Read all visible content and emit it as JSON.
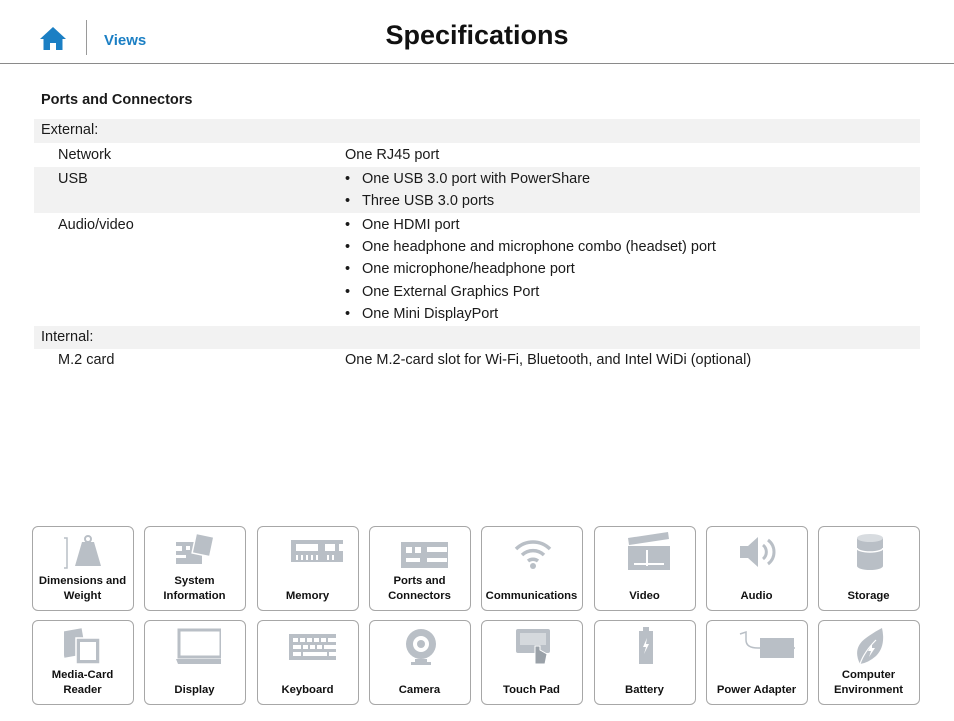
{
  "header": {
    "home_icon": "home-icon",
    "views_label": "Views",
    "title": "Specifications"
  },
  "section_title": "Ports and Connectors",
  "table": {
    "external_label": "External:",
    "network_label": "Network",
    "network_value": "One RJ45 port",
    "usb_label": "USB",
    "usb_items": [
      "One USB 3.0 port with PowerShare",
      "Three USB 3.0 ports"
    ],
    "av_label": "Audio/video",
    "av_items": [
      "One HDMI port",
      "One headphone and microphone combo (headset) port",
      "One microphone/headphone port",
      "One External Graphics Port",
      "One Mini DisplayPort"
    ],
    "internal_label": "Internal:",
    "m2_label": "M.2 card",
    "m2_value": "One M.2-card slot for Wi-Fi, Bluetooth, and Intel WiDi (optional)"
  },
  "bullet_char": "•",
  "tiles": [
    {
      "label_1": "Dimensions and",
      "label_2": "Weight",
      "icon": "weight-icon"
    },
    {
      "label_1": "System",
      "label_2": "Information",
      "icon": "motherboard-icon"
    },
    {
      "label_1": "Memory",
      "label_2": "",
      "icon": "memory-icon"
    },
    {
      "label_1": "Ports and",
      "label_2": "Connectors",
      "icon": "ports-icon"
    },
    {
      "label_1": "Communications",
      "label_2": "",
      "icon": "wifi-icon"
    },
    {
      "label_1": "Video",
      "label_2": "",
      "icon": "clapperboard-icon"
    },
    {
      "label_1": "Audio",
      "label_2": "",
      "icon": "speaker-icon"
    },
    {
      "label_1": "Storage",
      "label_2": "",
      "icon": "storage-icon"
    },
    {
      "label_1": "Media-Card",
      "label_2": "Reader",
      "icon": "media-card-icon"
    },
    {
      "label_1": "Display",
      "label_2": "",
      "icon": "display-icon"
    },
    {
      "label_1": "Keyboard",
      "label_2": "",
      "icon": "keyboard-icon"
    },
    {
      "label_1": "Camera",
      "label_2": "",
      "icon": "camera-icon"
    },
    {
      "label_1": "Touch Pad",
      "label_2": "",
      "icon": "touchpad-icon"
    },
    {
      "label_1": "Battery",
      "label_2": "",
      "icon": "battery-icon"
    },
    {
      "label_1": "Power Adapter",
      "label_2": "",
      "icon": "power-adapter-icon"
    },
    {
      "label_1": "Computer",
      "label_2": "Environment",
      "icon": "leaf-icon"
    }
  ],
  "colors": {
    "accent": "#1b7fc4",
    "row_shade": "#f2f2f2",
    "tile_border": "#a7a7a7",
    "icon_gray": "#b9bfc6"
  }
}
